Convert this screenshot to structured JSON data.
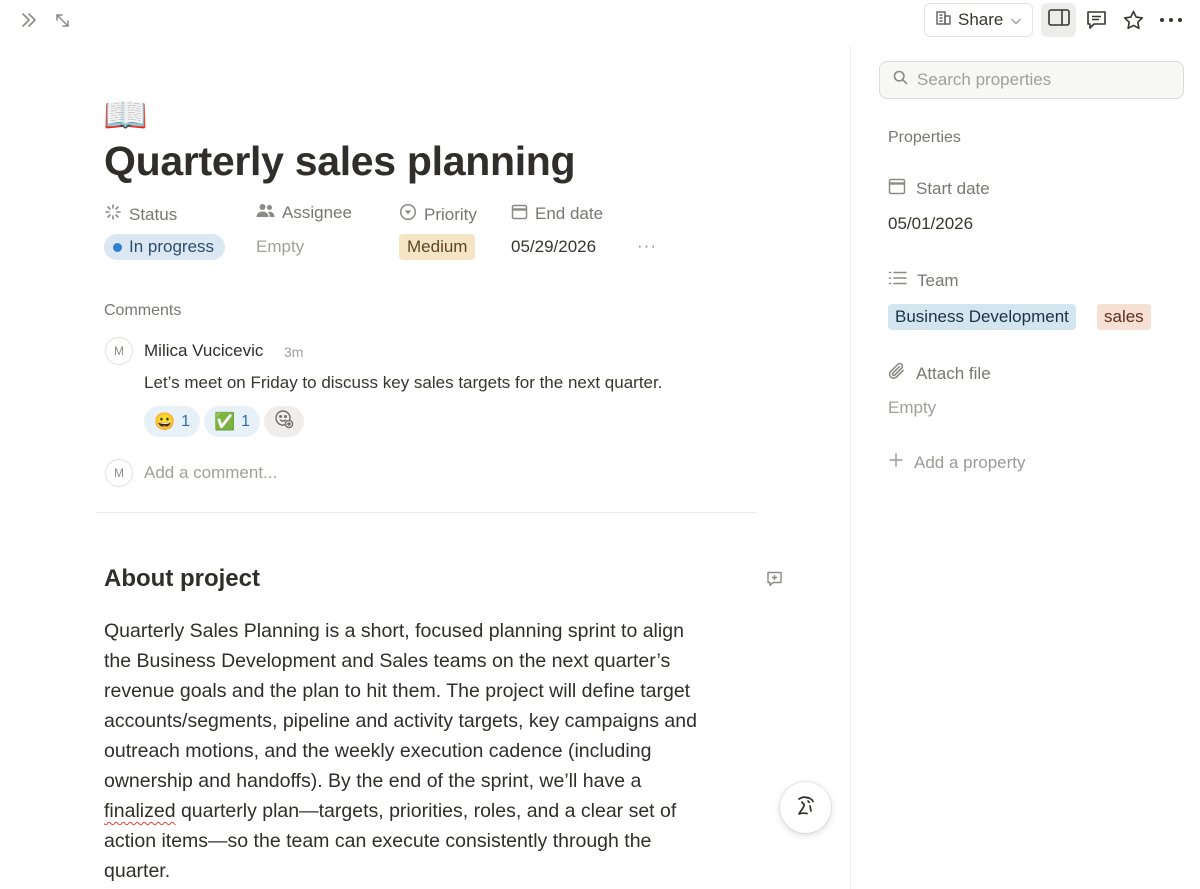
{
  "topbar": {
    "share_label": "Share",
    "icons": [
      "double-chevron-right-icon",
      "expand-icon",
      "building-icon",
      "chevron-down-icon",
      "side-panel-icon",
      "comment-icon",
      "star-icon",
      "more-icon"
    ]
  },
  "page": {
    "icon": "📖",
    "title": "Quarterly sales planning"
  },
  "properties": {
    "status": {
      "label": "Status",
      "value": "In progress",
      "color": "#2f80d1"
    },
    "assignee": {
      "label": "Assignee",
      "value": "Empty"
    },
    "priority": {
      "label": "Priority",
      "value": "Medium"
    },
    "end_date": {
      "label": "End date",
      "value": "05/29/2026"
    },
    "more": "···"
  },
  "comments": {
    "heading": "Comments",
    "items": [
      {
        "avatar": "M",
        "author": "Milica Vucicevic",
        "time": "3m",
        "text": "Let’s meet on Friday to discuss key sales targets for the next quarter.",
        "reactions": [
          {
            "emoji": "😀",
            "count": "1"
          },
          {
            "emoji": "✅",
            "count": "1"
          }
        ]
      }
    ],
    "input": {
      "avatar": "M",
      "placeholder": "Add a comment..."
    }
  },
  "about": {
    "heading": "About project",
    "lines": [
      "Quarterly Sales Planning is a short, focused planning sprint to align",
      "the Business Development and Sales teams on the next quarter’s",
      "revenue goals and the plan to hit them. The project will define target",
      "accounts/segments, pipeline and activity targets, key campaigns and",
      "outreach motions, and the weekly execution cadence (including",
      "ownership and handoffs). By the end of the sprint, we’ll have a"
    ],
    "line7_word": "finalized",
    "line7_rest": " quarterly plan—targets, priorities, roles, and a clear set of",
    "lines_after": [
      "action items—so the team can execute consistently through the",
      "quarter."
    ]
  },
  "side_panel": {
    "search_placeholder": "Search properties",
    "heading": "Properties",
    "start_date": {
      "label": "Start date",
      "value": "05/01/2026"
    },
    "team": {
      "label": "Team",
      "tags": [
        "Business Development",
        "sales"
      ]
    },
    "attach": {
      "label": "Attach file",
      "value": "Empty"
    },
    "add_property": "Add a property"
  }
}
